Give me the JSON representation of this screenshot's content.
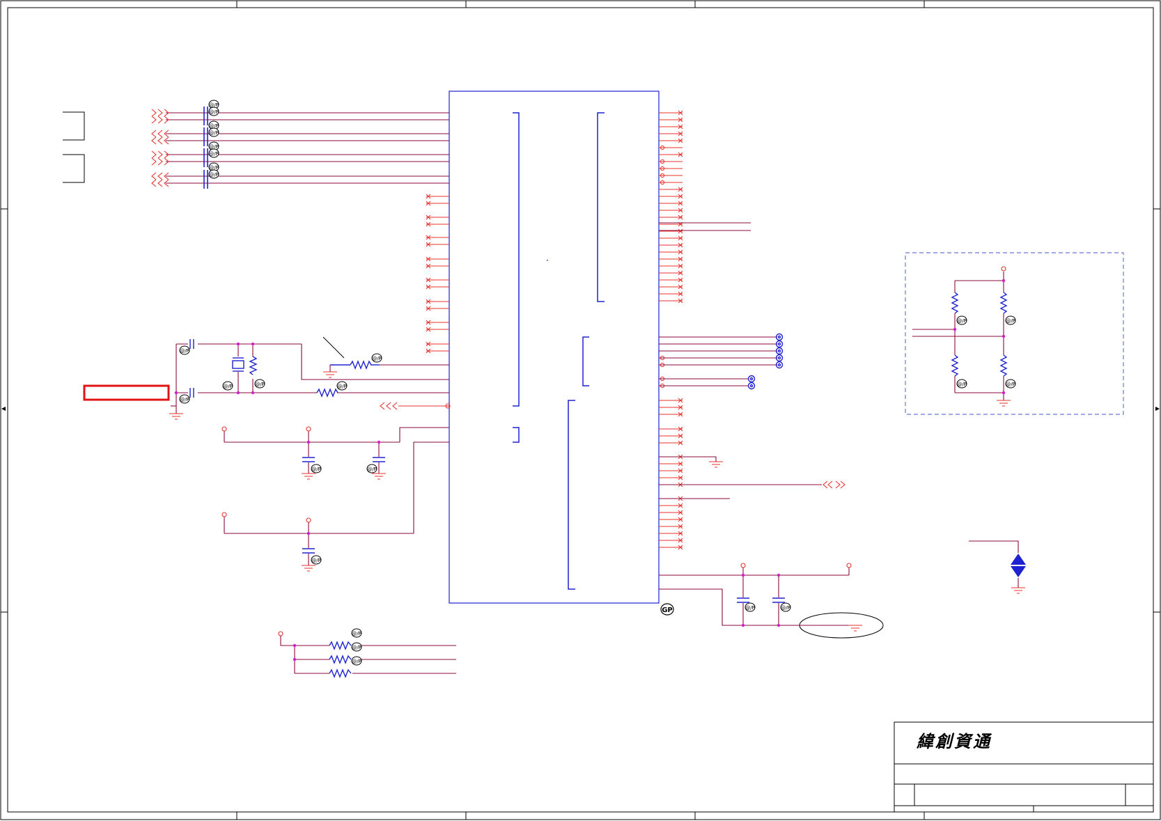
{
  "title_block": {
    "company": "緯創資通"
  },
  "badges": {
    "op": "@/P",
    "gp": "GP"
  },
  "colors": {
    "frame": "#000000",
    "wire": "#8b0a3c",
    "pin": "#e8322e",
    "symbol": "#1e22d0",
    "junction": "#d020c8",
    "highlight": "#e01414",
    "dashed": "#6a78d8"
  }
}
